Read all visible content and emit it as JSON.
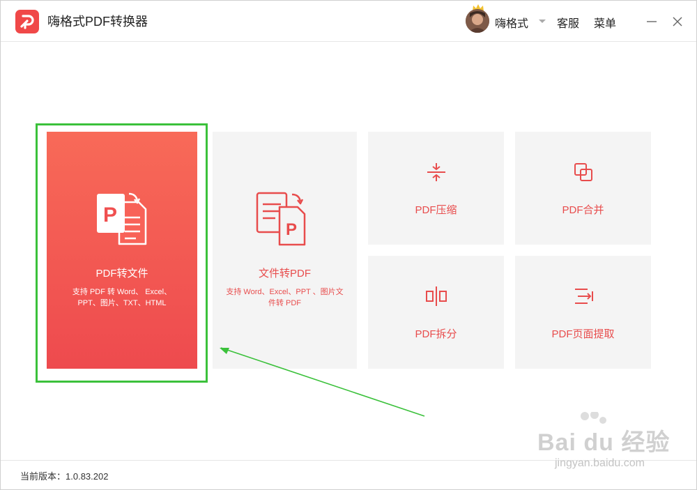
{
  "app": {
    "title": "嗨格式PDF转换器"
  },
  "header": {
    "username": "嗨格式",
    "service_label": "客服",
    "menu_label": "菜单"
  },
  "tiles": {
    "pdf_to_file": {
      "label": "PDF转文件",
      "desc_line1": "支持 PDF 转 Word、 Excel、",
      "desc_line2": "PPT、图片、TXT、HTML"
    },
    "file_to_pdf": {
      "label": "文件转PDF",
      "desc_line1": "支持 Word、Excel、PPT 、图片文",
      "desc_line2": "件转 PDF"
    },
    "compress": {
      "label": "PDF压缩"
    },
    "merge": {
      "label": "PDF合并"
    },
    "split": {
      "label": "PDF拆分"
    },
    "extract": {
      "label": "PDF页面提取"
    }
  },
  "footer": {
    "version_label": "当前版本：",
    "version": "1.0.83.202"
  },
  "watermark": {
    "brand": "Bai du 经验",
    "url": "jingyan.baidu.com"
  },
  "colors": {
    "accent": "#f04848",
    "tile_bg": "#f4f4f4",
    "highlight": "#3bc13b"
  }
}
